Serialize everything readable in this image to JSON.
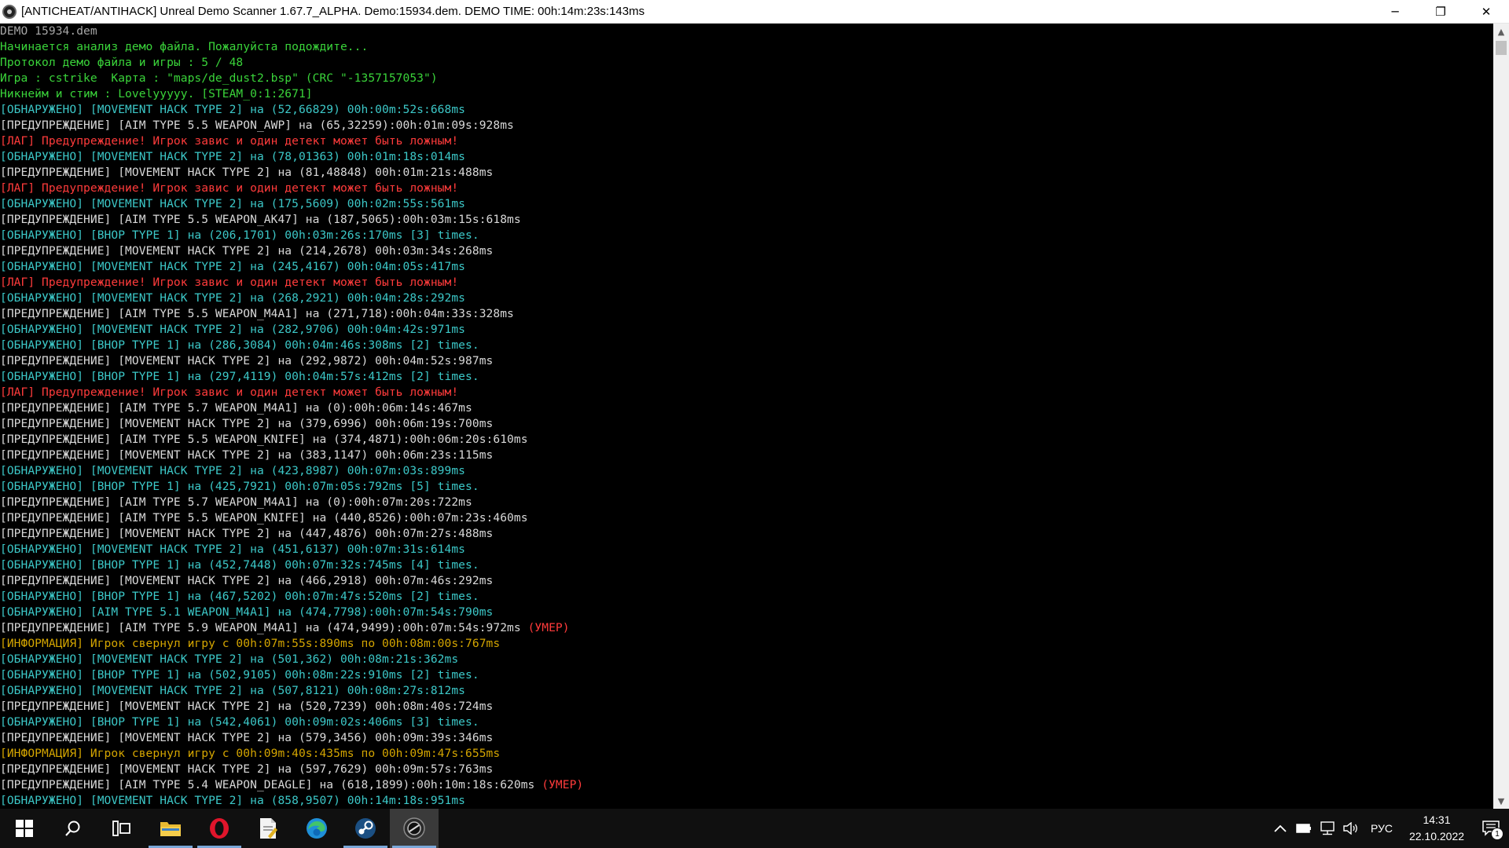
{
  "window": {
    "title": "[ANTICHEAT/ANTIHACK] Unreal Demo Scanner 1.67.7_ALPHA. Demo:15934.dem. DEMO TIME: 00h:14m:23s:143ms",
    "minimize": "─",
    "maximize": "❐",
    "close": "✕"
  },
  "colors": {
    "gray": "#a6a6a6",
    "green": "#3ad43a",
    "cyan": "#3cc8c8",
    "white": "#d9d9d9",
    "red": "#ff3b3b",
    "yellow": "#d4a500"
  },
  "console": {
    "lines": [
      {
        "color": "gray",
        "parts": [
          {
            "t": "DEMO 15934.dem"
          }
        ]
      },
      {
        "color": "green",
        "parts": [
          {
            "t": "Начинается анализ демо файла. Пожалуйста подождите..."
          }
        ]
      },
      {
        "color": "green",
        "parts": [
          {
            "t": "Протокол демо файла и игры : 5 / 48"
          }
        ]
      },
      {
        "color": "green",
        "parts": [
          {
            "t": "Игра : cstrike  Карта : \"maps/de_dust2.bsp\" (CRC \"-1357157053\")"
          }
        ]
      },
      {
        "color": "green",
        "parts": [
          {
            "t": "Никнейм и стим : Lovelyyyyy. [STEAM_0:1:2671]"
          }
        ]
      },
      {
        "color": "cyan",
        "parts": [
          {
            "t": "[ОБНАРУЖЕНО] [MOVEMENT HACK TYPE 2] на (52,66829) 00h:00m:52s:668ms"
          }
        ]
      },
      {
        "color": "white",
        "parts": [
          {
            "t": "[ПРЕДУПРЕЖДЕНИЕ] [AIM TYPE 5.5 WEAPON_AWP] на (65,32259):00h:01m:09s:928ms"
          }
        ]
      },
      {
        "color": "red",
        "parts": [
          {
            "t": "[ЛАГ] Предупреждение! Игрок завис и один детект может быть ложным!"
          }
        ]
      },
      {
        "color": "cyan",
        "parts": [
          {
            "t": "[ОБНАРУЖЕНО] [MOVEMENT HACK TYPE 2] на (78,01363) 00h:01m:18s:014ms"
          }
        ]
      },
      {
        "color": "white",
        "parts": [
          {
            "t": "[ПРЕДУПРЕЖДЕНИЕ] [MOVEMENT HACK TYPE 2] на (81,48848) 00h:01m:21s:488ms"
          }
        ]
      },
      {
        "color": "red",
        "parts": [
          {
            "t": "[ЛАГ] Предупреждение! Игрок завис и один детект может быть ложным!"
          }
        ]
      },
      {
        "color": "cyan",
        "parts": [
          {
            "t": "[ОБНАРУЖЕНО] [MOVEMENT HACK TYPE 2] на (175,5609) 00h:02m:55s:561ms"
          }
        ]
      },
      {
        "color": "white",
        "parts": [
          {
            "t": "[ПРЕДУПРЕЖДЕНИЕ] [AIM TYPE 5.5 WEAPON_AK47] на (187,5065):00h:03m:15s:618ms"
          }
        ]
      },
      {
        "color": "cyan",
        "parts": [
          {
            "t": "[ОБНАРУЖЕНО] [BHOP TYPE 1] на (206,1701) 00h:03m:26s:170ms [3] times."
          }
        ]
      },
      {
        "color": "white",
        "parts": [
          {
            "t": "[ПРЕДУПРЕЖДЕНИЕ] [MOVEMENT HACK TYPE 2] на (214,2678) 00h:03m:34s:268ms"
          }
        ]
      },
      {
        "color": "cyan",
        "parts": [
          {
            "t": "[ОБНАРУЖЕНО] [MOVEMENT HACK TYPE 2] на (245,4167) 00h:04m:05s:417ms"
          }
        ]
      },
      {
        "color": "red",
        "parts": [
          {
            "t": "[ЛАГ] Предупреждение! Игрок завис и один детект может быть ложным!"
          }
        ]
      },
      {
        "color": "cyan",
        "parts": [
          {
            "t": "[ОБНАРУЖЕНО] [MOVEMENT HACK TYPE 2] на (268,2921) 00h:04m:28s:292ms"
          }
        ]
      },
      {
        "color": "white",
        "parts": [
          {
            "t": "[ПРЕДУПРЕЖДЕНИЕ] [AIM TYPE 5.5 WEAPON_M4A1] на (271,718):00h:04m:33s:328ms"
          }
        ]
      },
      {
        "color": "cyan",
        "parts": [
          {
            "t": "[ОБНАРУЖЕНО] [MOVEMENT HACK TYPE 2] на (282,9706) 00h:04m:42s:971ms"
          }
        ]
      },
      {
        "color": "cyan",
        "parts": [
          {
            "t": "[ОБНАРУЖЕНО] [BHOP TYPE 1] на (286,3084) 00h:04m:46s:308ms [2] times."
          }
        ]
      },
      {
        "color": "white",
        "parts": [
          {
            "t": "[ПРЕДУПРЕЖДЕНИЕ] [MOVEMENT HACK TYPE 2] на (292,9872) 00h:04m:52s:987ms"
          }
        ]
      },
      {
        "color": "cyan",
        "parts": [
          {
            "t": "[ОБНАРУЖЕНО] [BHOP TYPE 1] на (297,4119) 00h:04m:57s:412ms [2] times."
          }
        ]
      },
      {
        "color": "red",
        "parts": [
          {
            "t": "[ЛАГ] Предупреждение! Игрок завис и один детект может быть ложным!"
          }
        ]
      },
      {
        "color": "white",
        "parts": [
          {
            "t": "[ПРЕДУПРЕЖДЕНИЕ] [AIM TYPE 5.7 WEAPON_M4A1] на (0):00h:06m:14s:467ms"
          }
        ]
      },
      {
        "color": "white",
        "parts": [
          {
            "t": "[ПРЕДУПРЕЖДЕНИЕ] [MOVEMENT HACK TYPE 2] на (379,6996) 00h:06m:19s:700ms"
          }
        ]
      },
      {
        "color": "white",
        "parts": [
          {
            "t": "[ПРЕДУПРЕЖДЕНИЕ] [AIM TYPE 5.5 WEAPON_KNIFE] на (374,4871):00h:06m:20s:610ms"
          }
        ]
      },
      {
        "color": "white",
        "parts": [
          {
            "t": "[ПРЕДУПРЕЖДЕНИЕ] [MOVEMENT HACK TYPE 2] на (383,1147) 00h:06m:23s:115ms"
          }
        ]
      },
      {
        "color": "cyan",
        "parts": [
          {
            "t": "[ОБНАРУЖЕНО] [MOVEMENT HACK TYPE 2] на (423,8987) 00h:07m:03s:899ms"
          }
        ]
      },
      {
        "color": "cyan",
        "parts": [
          {
            "t": "[ОБНАРУЖЕНО] [BHOP TYPE 1] на (425,7921) 00h:07m:05s:792ms [5] times."
          }
        ]
      },
      {
        "color": "white",
        "parts": [
          {
            "t": "[ПРЕДУПРЕЖДЕНИЕ] [AIM TYPE 5.7 WEAPON_M4A1] на (0):00h:07m:20s:722ms"
          }
        ]
      },
      {
        "color": "white",
        "parts": [
          {
            "t": "[ПРЕДУПРЕЖДЕНИЕ] [AIM TYPE 5.5 WEAPON_KNIFE] на (440,8526):00h:07m:23s:460ms"
          }
        ]
      },
      {
        "color": "white",
        "parts": [
          {
            "t": "[ПРЕДУПРЕЖДЕНИЕ] [MOVEMENT HACK TYPE 2] на (447,4876) 00h:07m:27s:488ms"
          }
        ]
      },
      {
        "color": "cyan",
        "parts": [
          {
            "t": "[ОБНАРУЖЕНО] [MOVEMENT HACK TYPE 2] на (451,6137) 00h:07m:31s:614ms"
          }
        ]
      },
      {
        "color": "cyan",
        "parts": [
          {
            "t": "[ОБНАРУЖЕНО] [BHOP TYPE 1] на (452,7448) 00h:07m:32s:745ms [4] times."
          }
        ]
      },
      {
        "color": "white",
        "parts": [
          {
            "t": "[ПРЕДУПРЕЖДЕНИЕ] [MOVEMENT HACK TYPE 2] на (466,2918) 00h:07m:46s:292ms"
          }
        ]
      },
      {
        "color": "cyan",
        "parts": [
          {
            "t": "[ОБНАРУЖЕНО] [BHOP TYPE 1] на (467,5202) 00h:07m:47s:520ms [2] times."
          }
        ]
      },
      {
        "color": "cyan",
        "parts": [
          {
            "t": "[ОБНАРУЖЕНО] [AIM TYPE 5.1 WEAPON_M4A1] на (474,7798):00h:07m:54s:790ms"
          }
        ]
      },
      {
        "color": "white",
        "parts": [
          {
            "t": "[ПРЕДУПРЕЖДЕНИЕ] [AIM TYPE 5.9 WEAPON_M4A1] на (474,9499):00h:07m:54s:972ms "
          },
          {
            "t": "(УМЕР)",
            "color": "red"
          }
        ]
      },
      {
        "color": "yellow",
        "parts": [
          {
            "t": "[ИНФОРМАЦИЯ] Игрок свернул игру с 00h:07m:55s:890ms по 00h:08m:00s:767ms"
          }
        ]
      },
      {
        "color": "cyan",
        "parts": [
          {
            "t": "[ОБНАРУЖЕНО] [MOVEMENT HACK TYPE 2] на (501,362) 00h:08m:21s:362ms"
          }
        ]
      },
      {
        "color": "cyan",
        "parts": [
          {
            "t": "[ОБНАРУЖЕНО] [BHOP TYPE 1] на (502,9105) 00h:08m:22s:910ms [2] times."
          }
        ]
      },
      {
        "color": "cyan",
        "parts": [
          {
            "t": "[ОБНАРУЖЕНО] [MOVEMENT HACK TYPE 2] на (507,8121) 00h:08m:27s:812ms"
          }
        ]
      },
      {
        "color": "white",
        "parts": [
          {
            "t": "[ПРЕДУПРЕЖДЕНИЕ] [MOVEMENT HACK TYPE 2] на (520,7239) 00h:08m:40s:724ms"
          }
        ]
      },
      {
        "color": "cyan",
        "parts": [
          {
            "t": "[ОБНАРУЖЕНО] [BHOP TYPE 1] на (542,4061) 00h:09m:02s:406ms [3] times."
          }
        ]
      },
      {
        "color": "white",
        "parts": [
          {
            "t": "[ПРЕДУПРЕЖДЕНИЕ] [MOVEMENT HACK TYPE 2] на (579,3456) 00h:09m:39s:346ms"
          }
        ]
      },
      {
        "color": "yellow",
        "parts": [
          {
            "t": "[ИНФОРМАЦИЯ] Игрок свернул игру с 00h:09m:40s:435ms по 00h:09m:47s:655ms"
          }
        ]
      },
      {
        "color": "white",
        "parts": [
          {
            "t": "[ПРЕДУПРЕЖДЕНИЕ] [MOVEMENT HACK TYPE 2] на (597,7629) 00h:09m:57s:763ms"
          }
        ]
      },
      {
        "color": "white",
        "parts": [
          {
            "t": "[ПРЕДУПРЕЖДЕНИЕ] [AIM TYPE 5.4 WEAPON_DEAGLE] на (618,1899):00h:10m:18s:620ms "
          },
          {
            "t": "(УМЕР)",
            "color": "red"
          }
        ]
      },
      {
        "color": "cyan",
        "parts": [
          {
            "t": "[ОБНАРУЖЕНО] [MOVEMENT HACK TYPE 2] на (858,9507) 00h:14m:18s:951ms"
          }
        ]
      }
    ]
  },
  "scrollbar": {
    "up": "▲",
    "down": "▼"
  },
  "taskbar": {
    "items": [
      {
        "name": "start-button",
        "icon": "windows-logo-icon"
      },
      {
        "name": "search-button",
        "icon": "search-icon"
      },
      {
        "name": "task-view-button",
        "icon": "task-view-icon"
      },
      {
        "name": "taskbar-file-explorer",
        "icon": "folder-icon",
        "active": true
      },
      {
        "name": "taskbar-opera",
        "icon": "opera-icon",
        "active": true
      },
      {
        "name": "taskbar-notepad",
        "icon": "document-icon"
      },
      {
        "name": "taskbar-edge",
        "icon": "edge-icon"
      },
      {
        "name": "taskbar-steam",
        "icon": "steam-icon",
        "active": true
      },
      {
        "name": "taskbar-demo-scanner",
        "icon": "scanner-app-icon",
        "active": true,
        "highlight": true
      }
    ],
    "tray": {
      "overflow": "^",
      "language": "РУС",
      "time": "14:31",
      "date": "22.10.2022",
      "notifications": "1"
    }
  }
}
